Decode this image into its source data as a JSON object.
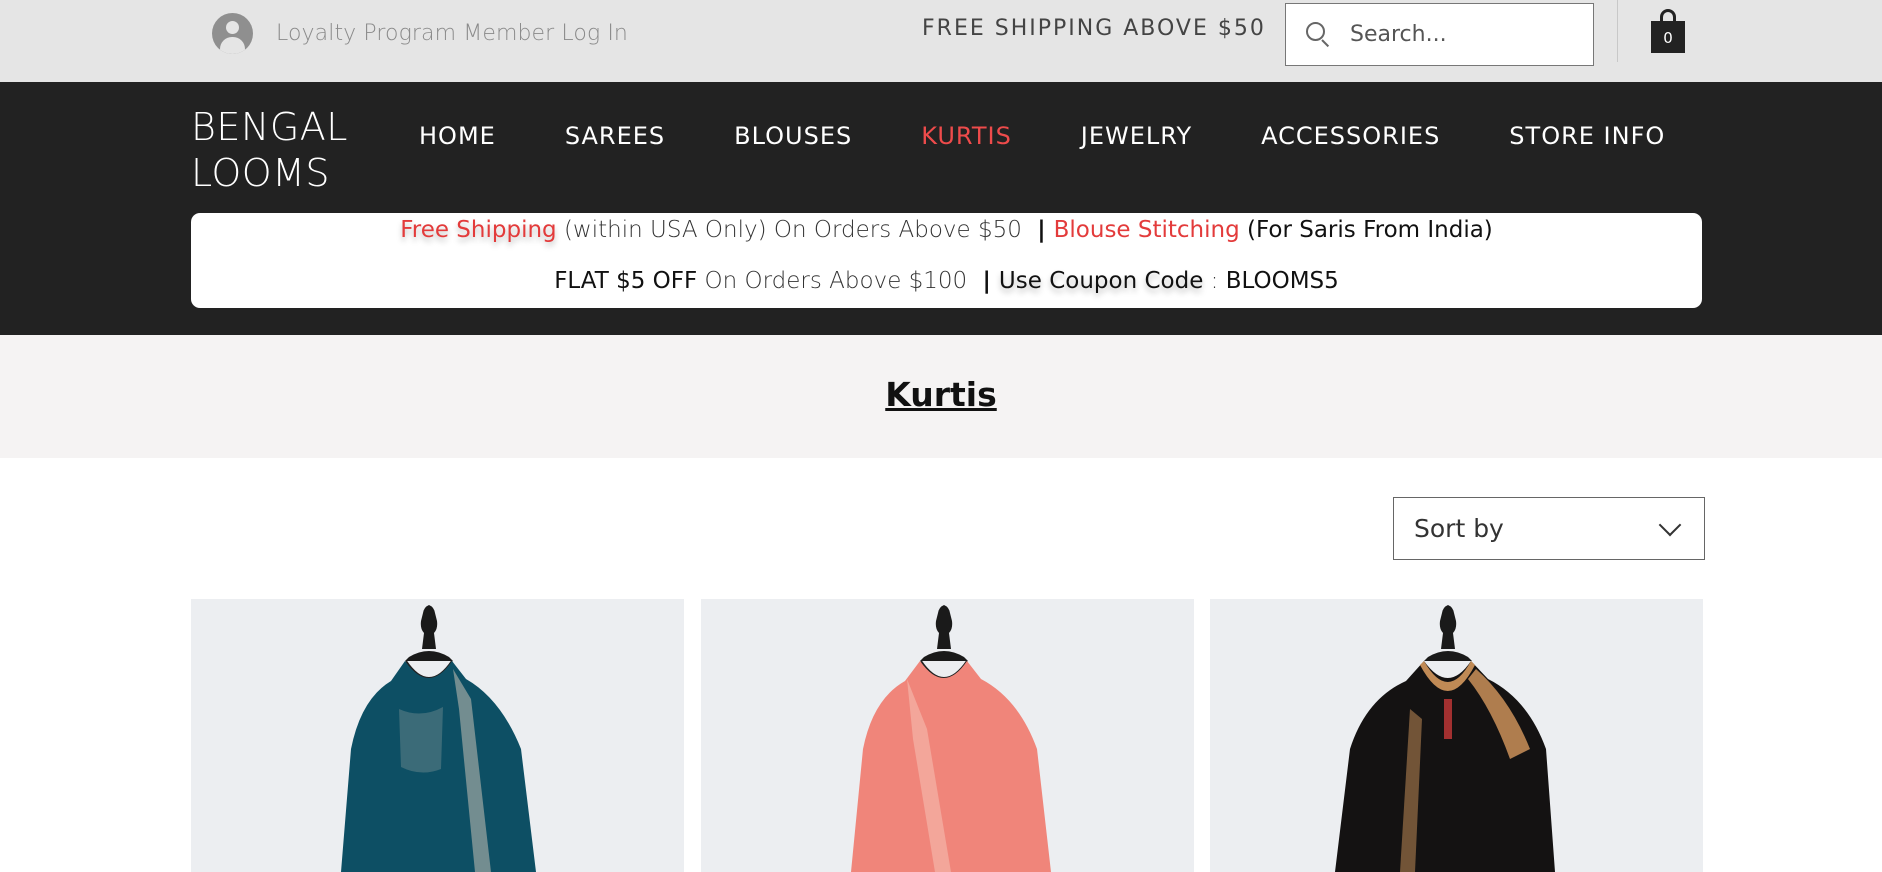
{
  "topbar": {
    "login_label": "Loyalty Program Member Log In",
    "promo": "FREE SHIPPING ABOVE $50",
    "search_placeholder": "Search...",
    "cart_count": "0"
  },
  "header": {
    "logo_line1": "BENGAL",
    "logo_line2": "LOOMS",
    "nav": [
      "HOME",
      "SAREES",
      "BLOUSES",
      "KURTIS",
      "JEWELRY",
      "ACCESSORIES",
      "STORE INFO"
    ],
    "active_nav": "KURTIS"
  },
  "banner": {
    "line1": {
      "free_shipping": "Free Shipping",
      "within": "(within USA Only) On Orders Above $50",
      "separator": "|",
      "blouse": "Blouse Stitching",
      "for_saris": "(For Saris From India)"
    },
    "line2": {
      "flat_off": "FLAT $5 OFF",
      "orders": "On Orders Above $100",
      "separator": "|",
      "coupon_label": "Use Coupon Code",
      "colon": ":",
      "coupon_code": "BLOOMS5"
    }
  },
  "page": {
    "title": "Kurtis",
    "sort_label": "Sort by"
  },
  "products": [
    {
      "color": "#0d4f64",
      "trim": "#c9c1b4"
    },
    {
      "color": "#f0857a",
      "trim": "#f3b3a8"
    },
    {
      "color": "#141212",
      "trim": "#c08a55"
    }
  ],
  "colors": {
    "topbar_bg": "#e5e5e5",
    "header_bg": "#222222",
    "accent_red": "#ee4b4b",
    "title_band_bg": "#f5f3f3"
  }
}
